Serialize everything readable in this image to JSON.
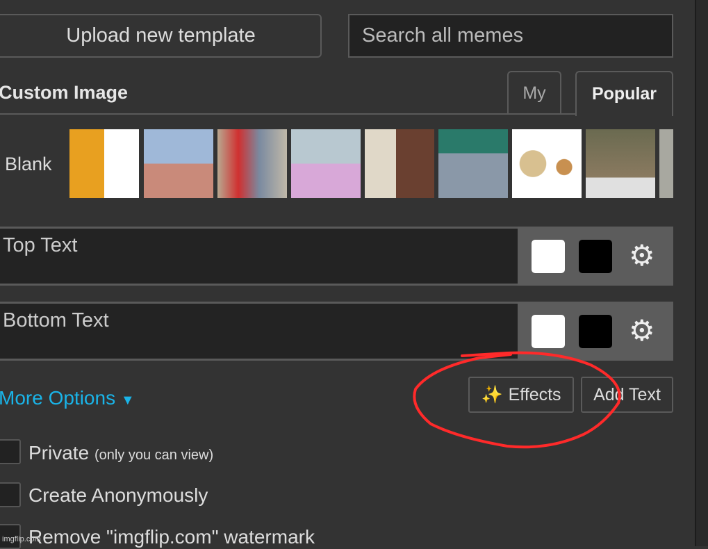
{
  "upload_button": "Upload new template",
  "search": {
    "placeholder": "Search all memes"
  },
  "section_title": "Custom Image",
  "tabs": [
    {
      "label": "My"
    },
    {
      "label": "Popular",
      "active": true
    }
  ],
  "blank_label": "Blank",
  "thumbnails": [
    "drake",
    "two-buttons",
    "distracted-boyfriend",
    "running-away-balloon",
    "uno-draw-25",
    "left-exit-12",
    "buff-doge-vs-cheems",
    "change-my-mind",
    "partial"
  ],
  "text_fields": [
    {
      "placeholder": "Top Text"
    },
    {
      "placeholder": "Bottom Text"
    }
  ],
  "colors": {
    "outline": "#ffffff",
    "fill": "#000000",
    "link": "#1ab4e8",
    "annotation": "#ff2a2a"
  },
  "more_options": "More Options",
  "effects_button": "Effects",
  "effects_icon": "✨",
  "add_text_button": "Add Text",
  "checkboxes": [
    {
      "label": "Private",
      "note": "(only you can view)"
    },
    {
      "label": "Create Anonymously"
    },
    {
      "label": "Remove \"imgflip.com\" watermark"
    }
  ],
  "watermark": "imgflip.com"
}
